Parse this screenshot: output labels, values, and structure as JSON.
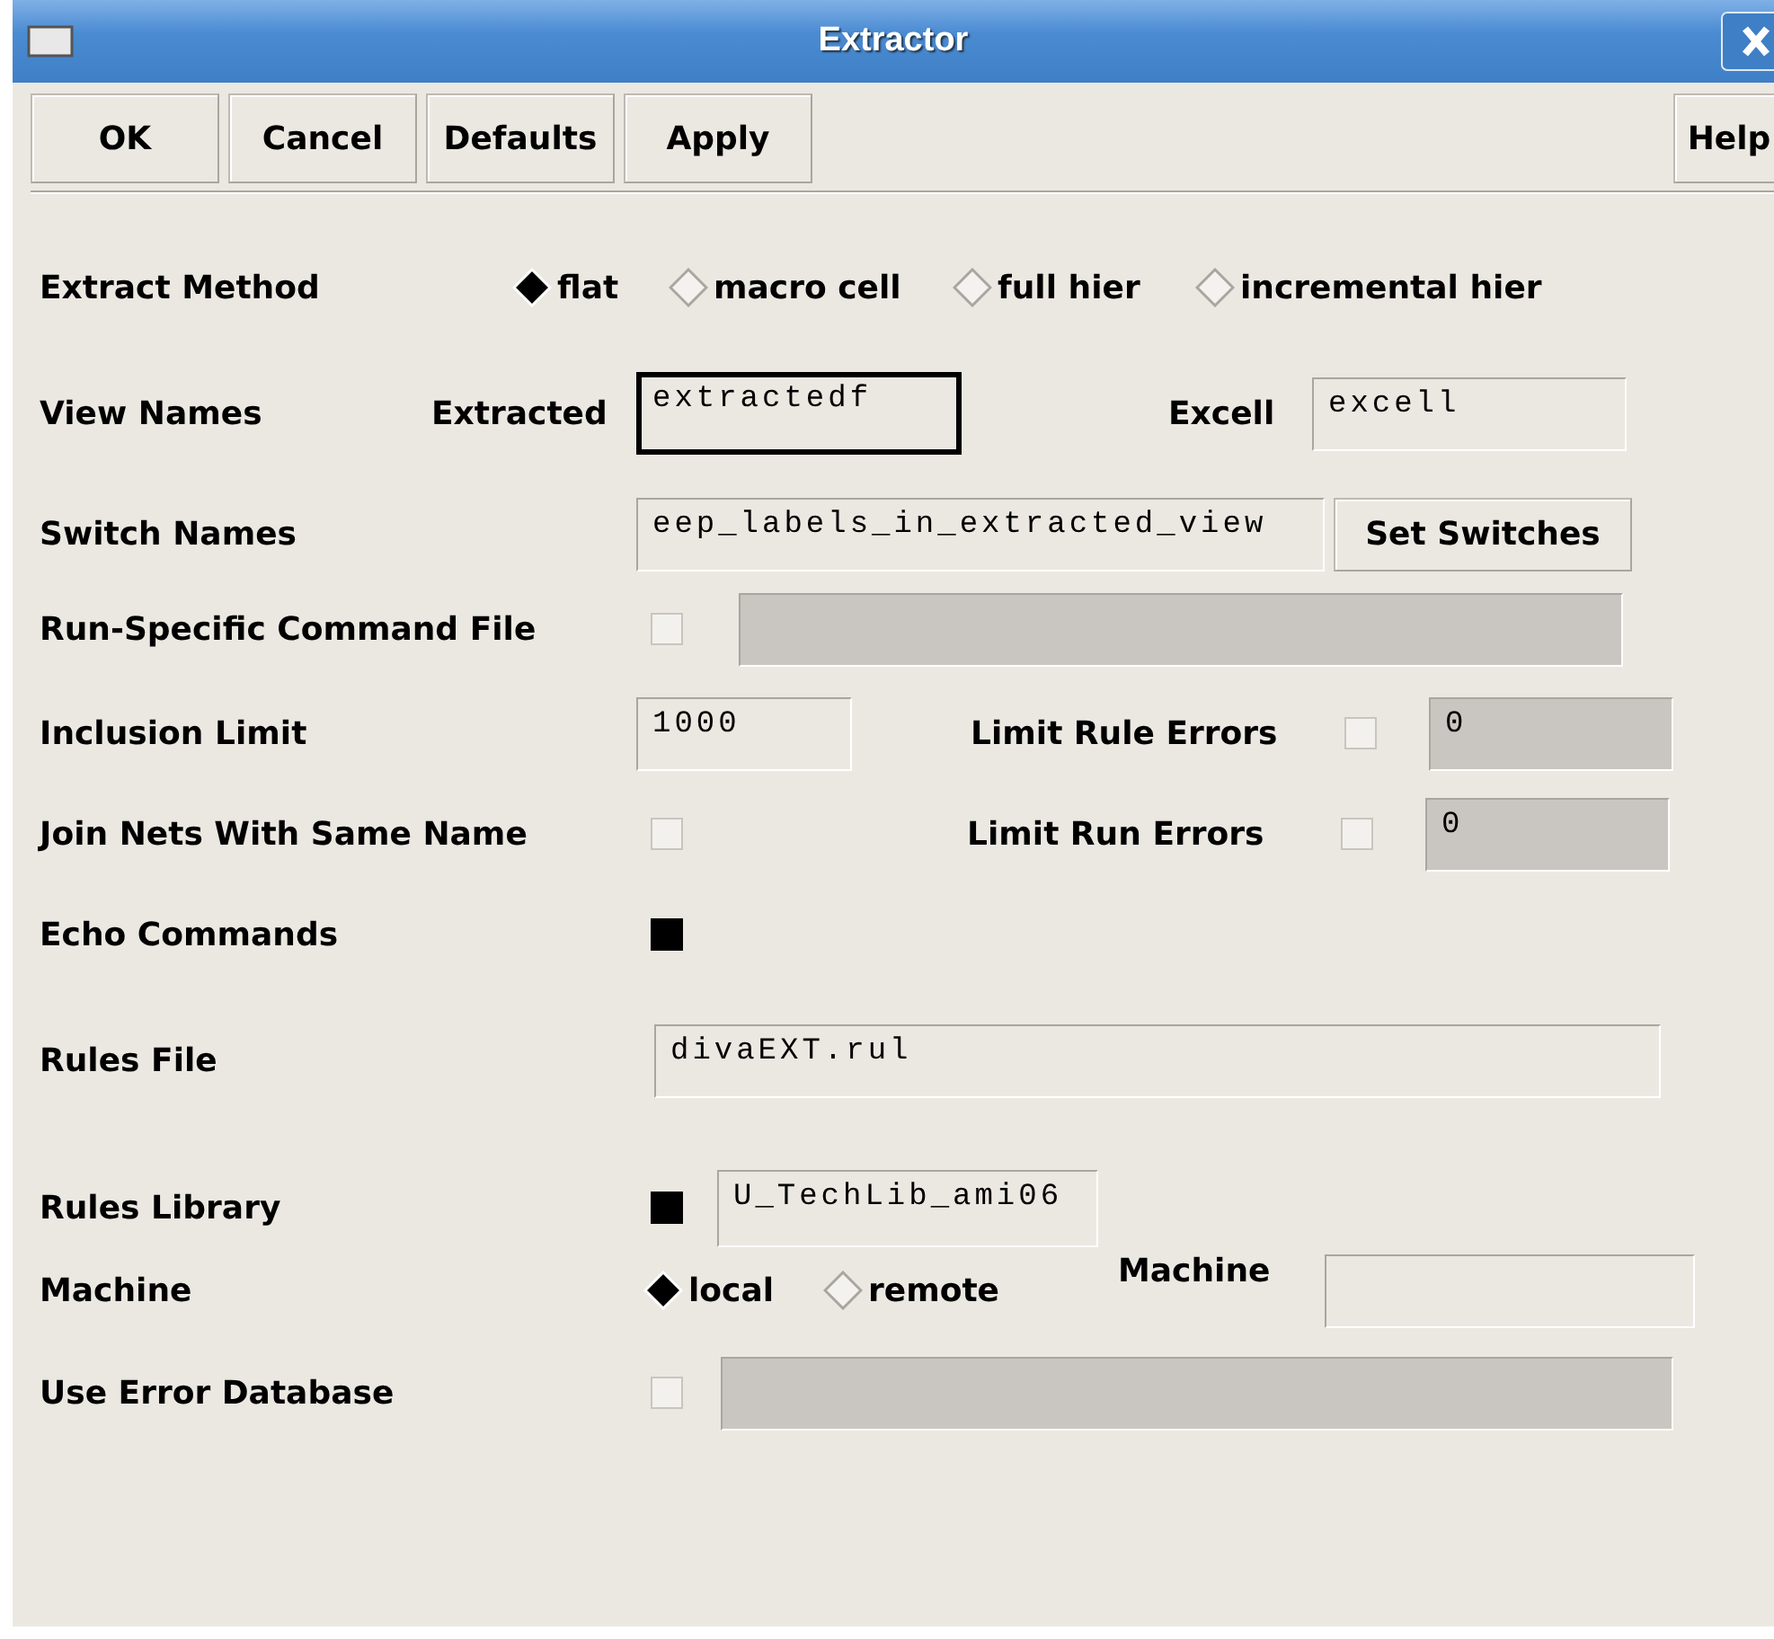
{
  "window": {
    "title": "Extractor"
  },
  "buttons": [
    {
      "label": "OK"
    },
    {
      "label": "Cancel"
    },
    {
      "label": "Defaults"
    },
    {
      "label": "Apply"
    },
    {
      "label": "Help"
    }
  ],
  "rows": [
    {
      "label": "Extract Method",
      "items": [
        {
          "kind": "radio",
          "label": "flat",
          "selected": true
        },
        {
          "kind": "radio",
          "label": "macro cell",
          "selected": false
        },
        {
          "kind": "radio",
          "label": "full hier",
          "selected": false
        },
        {
          "kind": "radio",
          "label": "incremental hier",
          "selected": false
        }
      ]
    },
    {
      "label": "View Names",
      "items": [
        {
          "kind": "text",
          "label": "Extracted"
        },
        {
          "kind": "field",
          "value": "extractedf",
          "focused": true,
          "disabled": false
        },
        {
          "kind": "text",
          "label": "Excell"
        },
        {
          "kind": "field",
          "value": "excell",
          "focused": false,
          "disabled": false
        }
      ]
    },
    {
      "label": "Switch Names",
      "items": [
        {
          "kind": "field",
          "value": "eep_labels_in_extracted_view",
          "focused": false,
          "disabled": false
        },
        {
          "kind": "button",
          "label": "Set Switches"
        }
      ]
    },
    {
      "label": "Run-Specific Command File",
      "items": [
        {
          "kind": "checkbox",
          "checked": false
        },
        {
          "kind": "field",
          "focused": false,
          "disabled": true
        }
      ]
    },
    {
      "label": "Inclusion Limit",
      "items": [
        {
          "kind": "field",
          "value": "1000",
          "focused": false,
          "disabled": false
        },
        {
          "kind": "text",
          "label": "Limit Rule Errors"
        },
        {
          "kind": "checkbox",
          "checked": false
        },
        {
          "kind": "field",
          "value": "0",
          "focused": false,
          "disabled": true
        }
      ]
    },
    {
      "label": "Join Nets With Same Name",
      "items": [
        {
          "kind": "checkbox",
          "checked": false
        },
        {
          "kind": "text",
          "label": "Limit Run Errors"
        },
        {
          "kind": "checkbox",
          "checked": false
        },
        {
          "kind": "field",
          "value": "0",
          "focused": false,
          "disabled": true
        }
      ]
    },
    {
      "label": "Echo Commands",
      "items": [
        {
          "kind": "checkbox",
          "checked": true
        }
      ]
    },
    {
      "label": "Rules File",
      "items": [
        {
          "kind": "field",
          "value": "divaEXT.rul",
          "focused": false,
          "disabled": false
        }
      ]
    },
    {
      "label": "Rules Library",
      "items": [
        {
          "kind": "checkbox",
          "checked": true
        },
        {
          "kind": "field",
          "value": "U_TechLib_ami06",
          "focused": false,
          "disabled": false
        }
      ]
    },
    {
      "label": "Machine",
      "items": [
        {
          "kind": "radio",
          "label": "local",
          "selected": true
        },
        {
          "kind": "radio",
          "label": "remote",
          "selected": false
        },
        {
          "kind": "text",
          "label": "Machine"
        },
        {
          "kind": "field",
          "focused": false,
          "disabled": false
        }
      ]
    },
    {
      "label": "Use Error Database",
      "items": [
        {
          "kind": "checkbox",
          "checked": false
        },
        {
          "kind": "field",
          "focused": false,
          "disabled": true
        }
      ]
    }
  ]
}
